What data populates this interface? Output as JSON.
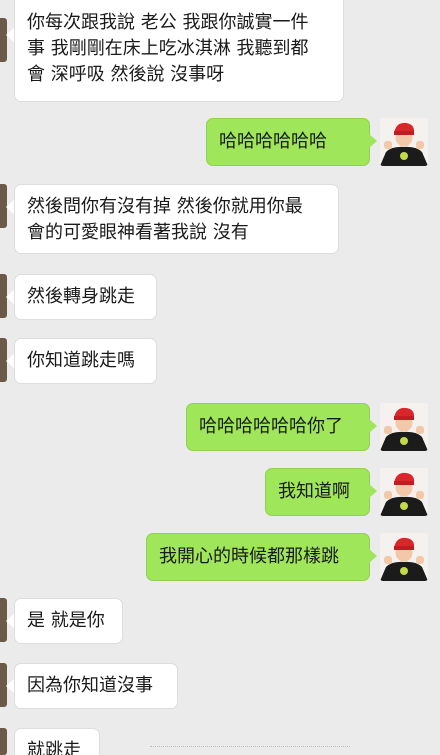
{
  "messages": [
    {
      "side": "in",
      "text": "你每次跟我說 老公 我跟你誠實一件\n事 我剛剛在床上吃冰淇淋 我聽到都\n會 深呼吸 然後說 沒事呀"
    },
    {
      "side": "out",
      "text": "哈哈哈哈哈哈"
    },
    {
      "side": "in",
      "text": "然後問你有沒有掉 然後你就用你最\n會的可愛眼神看著我說 沒有"
    },
    {
      "side": "in",
      "text": "然後轉身跳走"
    },
    {
      "side": "in",
      "text": "你知道跳走嗎"
    },
    {
      "side": "out",
      "text": "哈哈哈哈哈哈你了"
    },
    {
      "side": "out",
      "text": "我知道啊"
    },
    {
      "side": "out",
      "text": "我開心的時候都那樣跳"
    },
    {
      "side": "in",
      "text": "是 就是你"
    },
    {
      "side": "in",
      "text": "因為你知道沒事"
    },
    {
      "side": "in",
      "text": "就跳走"
    }
  ],
  "colors": {
    "background": "#ebebeb",
    "incoming_bubble": "#ffffff",
    "outgoing_bubble": "#9fe65a",
    "avatar_hat": "#d9262b"
  },
  "icons": {
    "contact_avatar": "partial-avatar",
    "self_avatar": "boy-red-cap-avatar"
  }
}
